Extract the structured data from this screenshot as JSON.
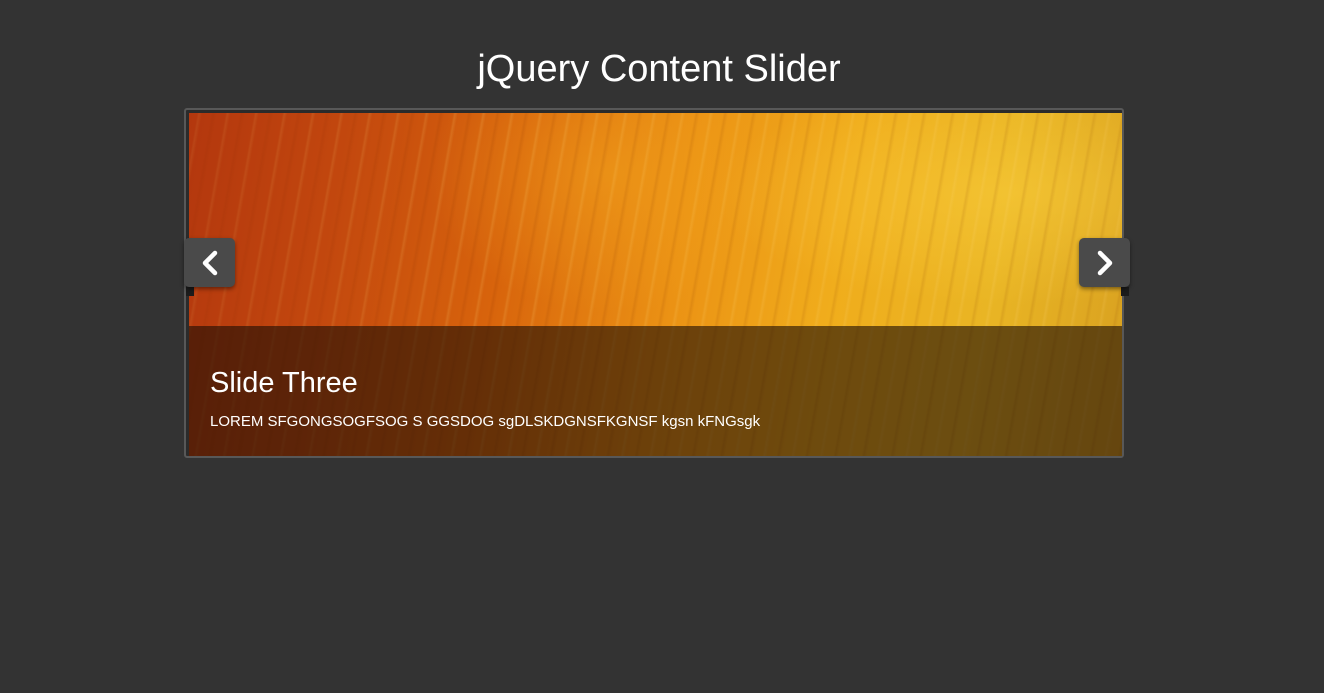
{
  "page": {
    "title": "jQuery Content Slider"
  },
  "slider": {
    "current_slide": {
      "title": "Slide Three",
      "text": "LOREM SFGONGSOGFSOG S GGSDOG sgDLSKDGNSFKGNSF kgsn kFNGsgk"
    },
    "controls": {
      "prev_icon": "chevron-left-icon",
      "next_icon": "chevron-right-icon"
    }
  },
  "colors": {
    "background": "#333333",
    "frame_border": "#585858",
    "nav_button": "#4a4a4a",
    "caption_text": "#ffffff"
  }
}
